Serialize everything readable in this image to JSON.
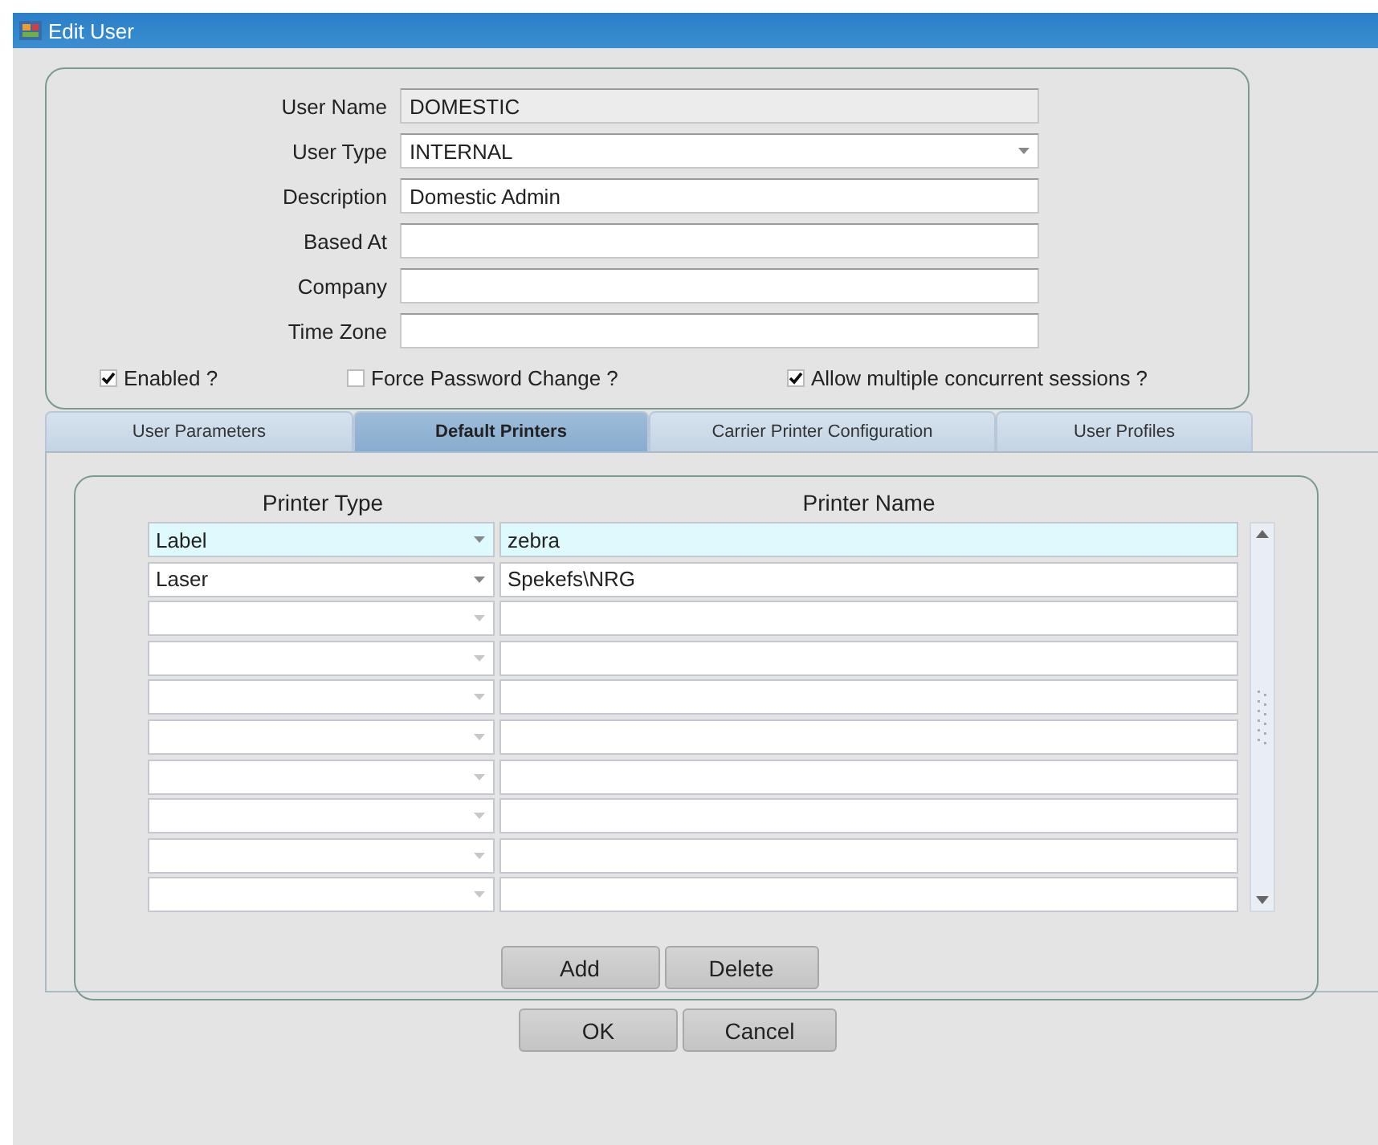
{
  "window": {
    "title": "Edit User"
  },
  "fields": [
    {
      "label": "User Name",
      "value": "DOMESTIC",
      "kind": "readonly"
    },
    {
      "label": "User Type",
      "value": "INTERNAL",
      "kind": "dropdown"
    },
    {
      "label": "Description",
      "value": "Domestic Admin",
      "kind": "text"
    },
    {
      "label": "Based At",
      "kind": "text"
    },
    {
      "label": "Company",
      "kind": "text"
    },
    {
      "label": "Time Zone",
      "kind": "text"
    }
  ],
  "checkboxes": [
    {
      "label": "Enabled ?",
      "checked": true
    },
    {
      "label": "Force Password Change ?",
      "checked": false
    },
    {
      "label": "Allow multiple concurrent sessions ?",
      "checked": true
    }
  ],
  "tabs": [
    {
      "label": "User Parameters",
      "selected": false
    },
    {
      "label": "Default Printers",
      "selected": true
    },
    {
      "label": "Carrier Printer Configuration",
      "selected": false
    },
    {
      "label": "User Profiles",
      "selected": false
    }
  ],
  "table": {
    "columns": [
      "Printer Type",
      "Printer Name"
    ],
    "rows": [
      {
        "printer_type": "Label",
        "printer_name": "zebra",
        "selected": true
      },
      {
        "printer_type": "Laser",
        "printer_name": "Spekefs\\NRG",
        "selected": false
      },
      {
        "selected": false
      },
      {
        "selected": false
      },
      {
        "selected": false
      },
      {
        "selected": false
      },
      {
        "selected": false
      },
      {
        "selected": false
      },
      {
        "selected": false
      },
      {
        "selected": false
      }
    ]
  },
  "table_buttons": [
    "Add",
    "Delete"
  ],
  "buttons": [
    "OK",
    "Cancel"
  ]
}
